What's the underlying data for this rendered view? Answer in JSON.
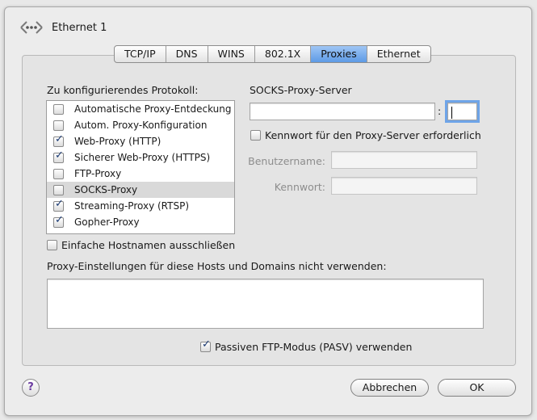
{
  "header": {
    "title": "Ethernet 1",
    "icon": "network-port-icon"
  },
  "tabs": [
    {
      "label": "TCP/IP",
      "active": false
    },
    {
      "label": "DNS",
      "active": false
    },
    {
      "label": "WINS",
      "active": false
    },
    {
      "label": "802.1X",
      "active": false
    },
    {
      "label": "Proxies",
      "active": true
    },
    {
      "label": "Ethernet",
      "active": false
    }
  ],
  "protocols": {
    "label": "Zu konfigurierendes Protokoll:",
    "items": [
      {
        "label": "Automatische Proxy-Entdeckung",
        "checked": false,
        "selected": false
      },
      {
        "label": "Autom. Proxy-Konfiguration",
        "checked": false,
        "selected": false
      },
      {
        "label": "Web-Proxy (HTTP)",
        "checked": true,
        "selected": false
      },
      {
        "label": "Sicherer Web-Proxy (HTTPS)",
        "checked": true,
        "selected": false
      },
      {
        "label": "FTP-Proxy",
        "checked": false,
        "selected": false
      },
      {
        "label": "SOCKS-Proxy",
        "checked": false,
        "selected": true
      },
      {
        "label": "Streaming-Proxy (RTSP)",
        "checked": true,
        "selected": false
      },
      {
        "label": "Gopher-Proxy",
        "checked": true,
        "selected": false
      }
    ]
  },
  "server": {
    "title": "SOCKS-Proxy-Server",
    "host_value": "",
    "port_separator": ":",
    "port_value": "",
    "password_required_label": "Kennwort für den Proxy-Server erforderlich",
    "password_required_checked": false,
    "username_label": "Benutzername:",
    "username_value": "",
    "password_label": "Kennwort:",
    "password_value": ""
  },
  "exclude_simple": {
    "label": "Einfache Hostnamen ausschließen",
    "checked": false
  },
  "bypass": {
    "label": "Proxy-Einstellungen für diese Hosts und Domains nicht verwenden:",
    "value": ""
  },
  "pasv": {
    "label": "Passiven FTP-Modus (PASV) verwenden",
    "checked": true
  },
  "buttons": {
    "help": "?",
    "cancel": "Abbrechen",
    "ok": "OK"
  }
}
